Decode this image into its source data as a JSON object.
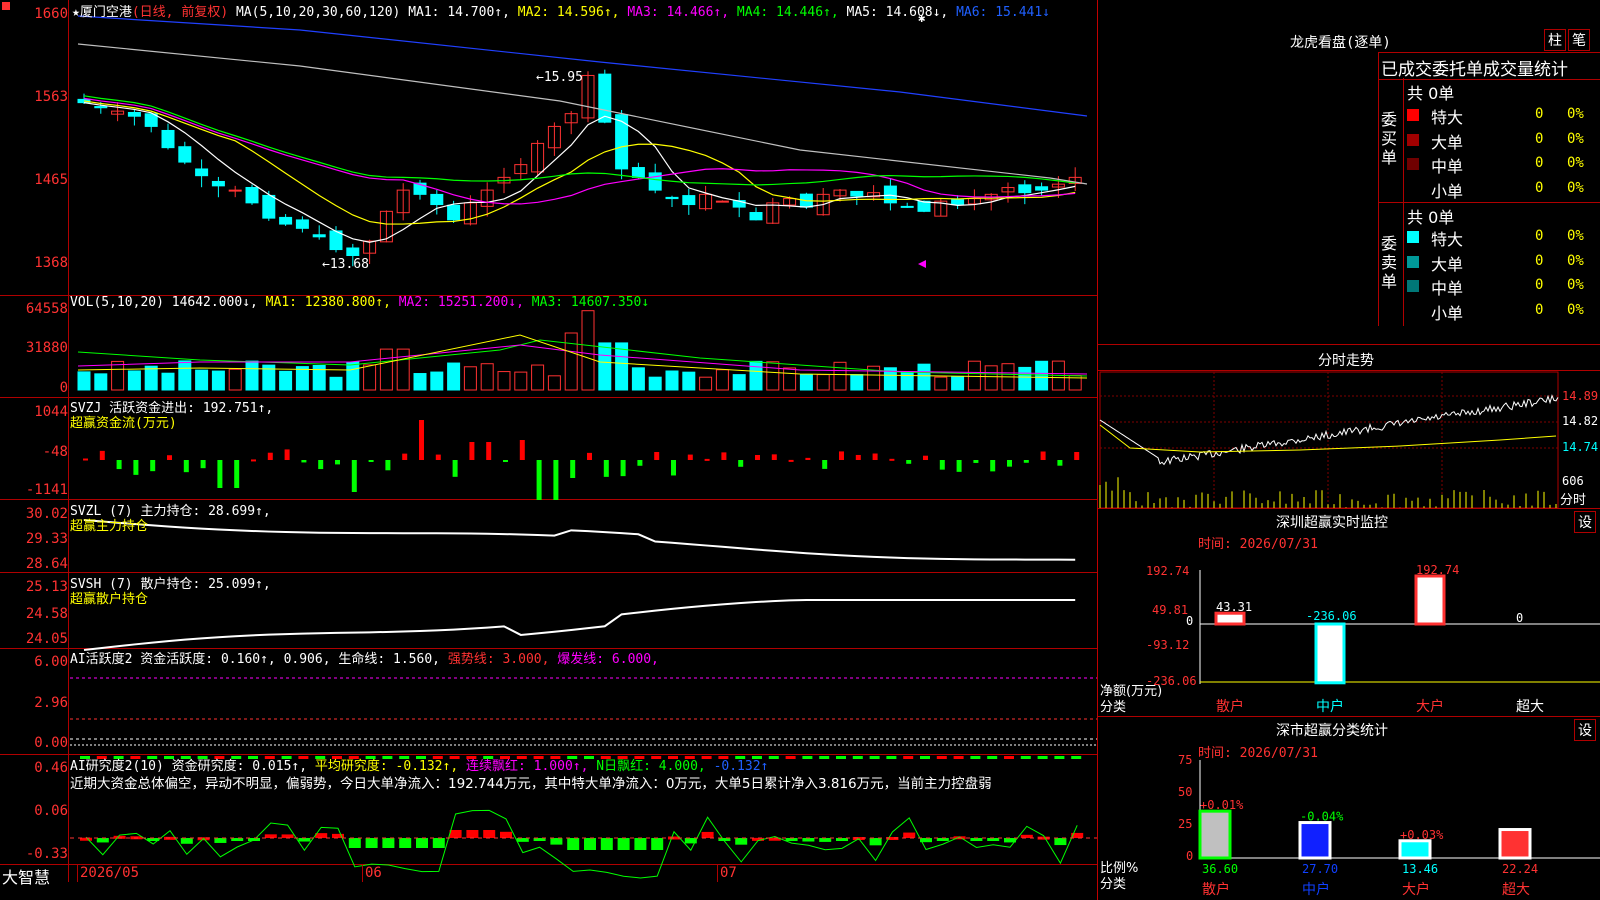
{
  "left_axis": {
    "k": [
      "1660",
      "1563",
      "1465",
      "1368"
    ],
    "vol": [
      "64558",
      "31880",
      "0"
    ],
    "svzj": [
      "1044",
      "-48",
      "-1141"
    ],
    "svzl": [
      "30.02",
      "29.33",
      "28.64"
    ],
    "svsh": [
      "25.13",
      "24.58",
      "24.05"
    ],
    "ai": [
      "6.00",
      "2.96",
      "0.00"
    ],
    "ai2": [
      "0.46",
      "0.06",
      "-0.33"
    ]
  },
  "kline_header": {
    "star": "★",
    "name": "厦门空港",
    "mode": "(日线, 前复权)",
    "ma_params": "MA(5,10,20,30,60,120)",
    "ma1": "MA1: 14.700↑,",
    "ma2": "MA2: 14.596↑,",
    "ma3": "MA3: 14.466↑,",
    "ma4": "MA4: 14.446↑,",
    "ma5": "MA5: 14.608↓,",
    "ma6": "MA6: 15.441↓"
  },
  "annotations": {
    "high": "←15.95",
    "low": "←13.68"
  },
  "vol_header": {
    "label": "VOL(5,10,20)",
    "val": "14642.000↓,",
    "ma1": "MA1: 12380.800↑,",
    "ma2": "MA2: 15251.200↓,",
    "ma3": "MA3: 14607.350↓"
  },
  "svzj_header": {
    "label": "SVZJ  活跃资金进出: 192.751↑,",
    "sub": "超赢资金流(万元)"
  },
  "svzl_header": {
    "label": "SVZL (7) 主力持仓: 28.699↑,",
    "sub": "超赢主力持仓"
  },
  "svsh_header": {
    "label": "SVSH (7) 散户持仓: 25.099↑,",
    "sub": "超赢散户持仓"
  },
  "ai_header": {
    "label": "AI活跃度2 资金活跃度: 0.160↑, 0.906, 生命线: 1.560,",
    "strong": "强势线: 3.000,",
    "burst": "爆发线: 6.000,"
  },
  "ai2_header": {
    "label": "AI研究度2(10) 资金研究度: 0.015↑,",
    "avg": "平均研究度: -0.132↑,",
    "cont": "连续飘红: 1.000↑,",
    "nday": "N日飘红: 4.000,",
    "last": "-0.132↑"
  },
  "ai2_summary": "近期大资金总体偏空，异动不明显，偏弱势，今日大单净流入：192.744万元，其中特大单净流入：0万元，大单5日累计净入3.816万元，当前主力控盘弱",
  "bottom": {
    "logo": "大智慧",
    "d1": "2026/05",
    "d2": "06",
    "d3": "07"
  },
  "right": {
    "lhb_title": "龙虎看盘(逐单)",
    "btn_zhu": "柱",
    "btn_bi": "笔",
    "tabs": "已成交委托单成交量统计",
    "buy_total": "共 0单",
    "sell_total": "共 0单",
    "buy_side": [
      "委",
      "买",
      "单"
    ],
    "sell_side": [
      "委",
      "卖",
      "单"
    ],
    "buy_rows": [
      {
        "name": "特大",
        "v": "0",
        "p": "0%",
        "color": "#ff0000"
      },
      {
        "name": "大单",
        "v": "0",
        "p": "0%",
        "color": "#a00000"
      },
      {
        "name": "中单",
        "v": "0",
        "p": "0%",
        "color": "#700000"
      },
      {
        "name": "小单",
        "v": "0",
        "p": "0%",
        "color": "#000000"
      }
    ],
    "sell_rows": [
      {
        "name": "特大",
        "v": "0",
        "p": "0%",
        "color": "#00ffff"
      },
      {
        "name": "大单",
        "v": "0",
        "p": "0%",
        "color": "#009999"
      },
      {
        "name": "中单",
        "v": "0",
        "p": "0%",
        "color": "#007777"
      },
      {
        "name": "小单",
        "v": "0",
        "p": "0%",
        "color": "#000000"
      }
    ],
    "fenshi_title": "分时走势",
    "fenshi_prices": [
      "14.89",
      "14.82",
      "14.74"
    ],
    "fenshi_vol": "606",
    "fenshi_label": "分时",
    "mon_title": "深圳超赢实时监控",
    "mon_time": "时间: 2026/07/31",
    "mon_btn": "设",
    "mon_axis": [
      "192.74",
      "49.81",
      "0",
      "-93.12",
      "-236.06"
    ],
    "mon_unit": "净额(万元)",
    "mon_cat_label": "分类",
    "stat_title": "深市超赢分类统计",
    "stat_time": "时间: 2026/07/31",
    "stat_btn": "设",
    "stat_axis": [
      "75",
      "50",
      "25",
      "0"
    ],
    "stat_unit": "比例%",
    "stat_cat_label": "分类"
  },
  "chart_data": [
    {
      "type": "bar",
      "title": "深圳超赢实时监控",
      "categories": [
        "散户",
        "中户",
        "大户",
        "超大"
      ],
      "values": [
        43.31,
        -236.06,
        192.74,
        0
      ],
      "labels": [
        "43.31",
        "-236.06",
        "192.74",
        "0"
      ],
      "ylabel": "净额(万元)",
      "ylim": [
        -236.06,
        192.74
      ]
    },
    {
      "type": "bar",
      "title": "深市超赢分类统计",
      "categories": [
        "散户",
        "中户",
        "大户",
        "超大"
      ],
      "values": [
        36.6,
        27.7,
        13.46,
        22.24
      ],
      "labels": [
        "36.60",
        "27.70",
        "13.46",
        "22.24"
      ],
      "changes": [
        "+0.01%",
        "-0.04%",
        "+0.03%",
        ""
      ],
      "ylabel": "比例%",
      "ylim": [
        0,
        75
      ]
    }
  ]
}
